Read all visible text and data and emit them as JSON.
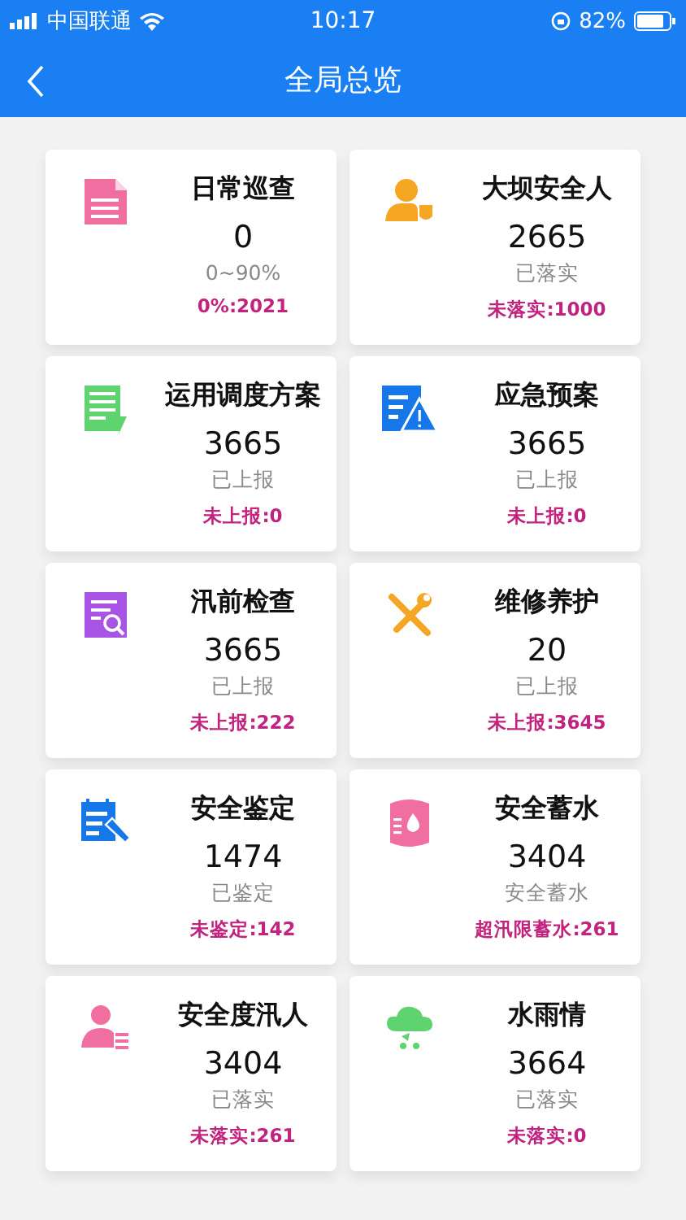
{
  "status_bar": {
    "carrier": "中国联通",
    "time": "10:17",
    "battery": "82%"
  },
  "nav_bar": {
    "title": "全局总览"
  },
  "cards": [
    {
      "title": "日常巡查",
      "value": "0",
      "caption": "0~90%",
      "alert": "0%:2021"
    },
    {
      "title": "大坝安全人",
      "value": "2665",
      "caption": "已落实",
      "alert": "未落实:1000"
    },
    {
      "title": "运用调度方案",
      "value": "3665",
      "caption": "已上报",
      "alert": "未上报:0"
    },
    {
      "title": "应急预案",
      "value": "3665",
      "caption": "已上报",
      "alert": "未上报:0"
    },
    {
      "title": "汛前检查",
      "value": "3665",
      "caption": "已上报",
      "alert": "未上报:222"
    },
    {
      "title": "维修养护",
      "value": "20",
      "caption": "已上报",
      "alert": "未上报:3645"
    },
    {
      "title": "安全鉴定",
      "value": "1474",
      "caption": "已鉴定",
      "alert": "未鉴定:142"
    },
    {
      "title": "安全蓄水",
      "value": "3404",
      "caption": "安全蓄水",
      "alert": "超汛限蓄水:261"
    },
    {
      "title": "安全度汛人",
      "value": "3404",
      "caption": "已落实",
      "alert": "未落实:261"
    },
    {
      "title": "水雨情",
      "value": "3664",
      "caption": "已落实",
      "alert": "未落实:0"
    }
  ]
}
